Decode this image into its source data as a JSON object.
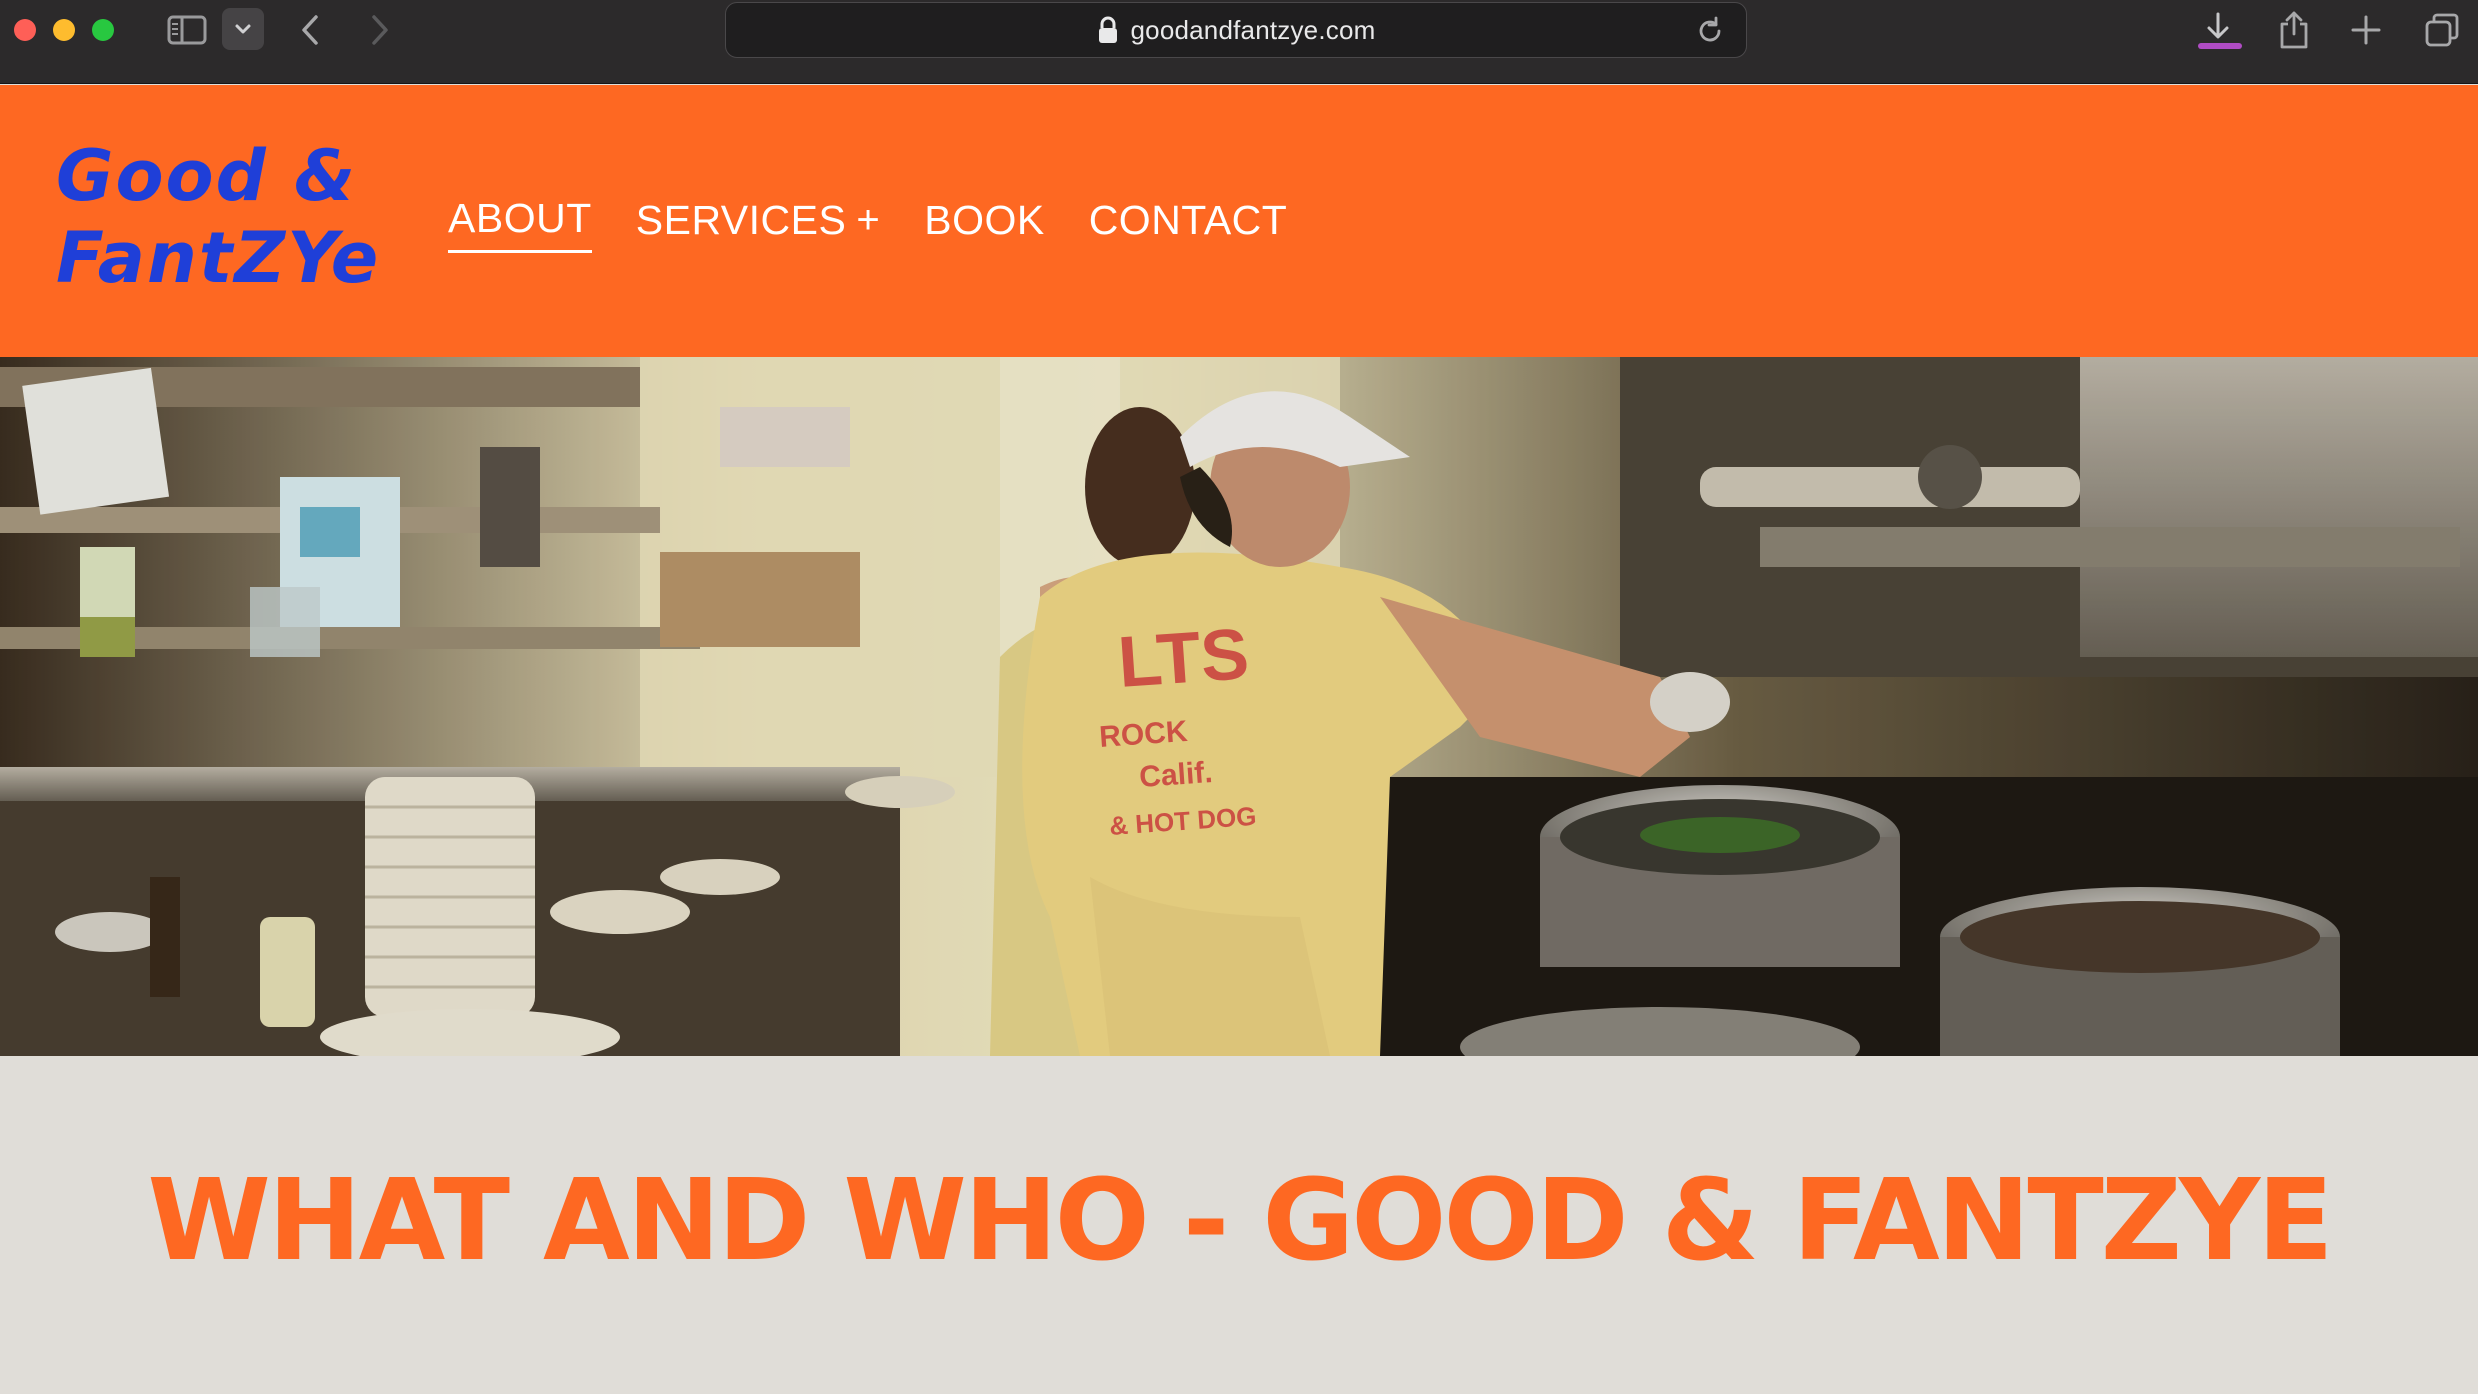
{
  "browser": {
    "url": "goodandfantzye.com",
    "icons": [
      "sidebar-icon",
      "chevron-down-icon",
      "back-arrow-icon",
      "forward-arrow-icon",
      "lock-icon",
      "reload-icon",
      "download-icon",
      "share-icon",
      "plus-icon",
      "tabs-overview-icon"
    ]
  },
  "site": {
    "logo": {
      "line1": "Good &",
      "line2": "FantZYe"
    },
    "nav": [
      {
        "label": "ABOUT",
        "active": true
      },
      {
        "label": "SERVICES",
        "suffix": "+"
      },
      {
        "label": "BOOK"
      },
      {
        "label": "CONTACT"
      }
    ],
    "hero_shirt_text": {
      "line1": "LTS",
      "line2": "ROCK",
      "line3": "Calif.",
      "line4": "& HOT DOG"
    },
    "headline": "WHAT AND WHO - GOOD & FANTZYE"
  },
  "colors": {
    "brand_orange": "#fe6822",
    "logo_blue": "#1f3fd8",
    "section_bg": "#e0ddd8",
    "chrome_bg": "#2c2a2b",
    "download_progress": "#b04cc4"
  }
}
